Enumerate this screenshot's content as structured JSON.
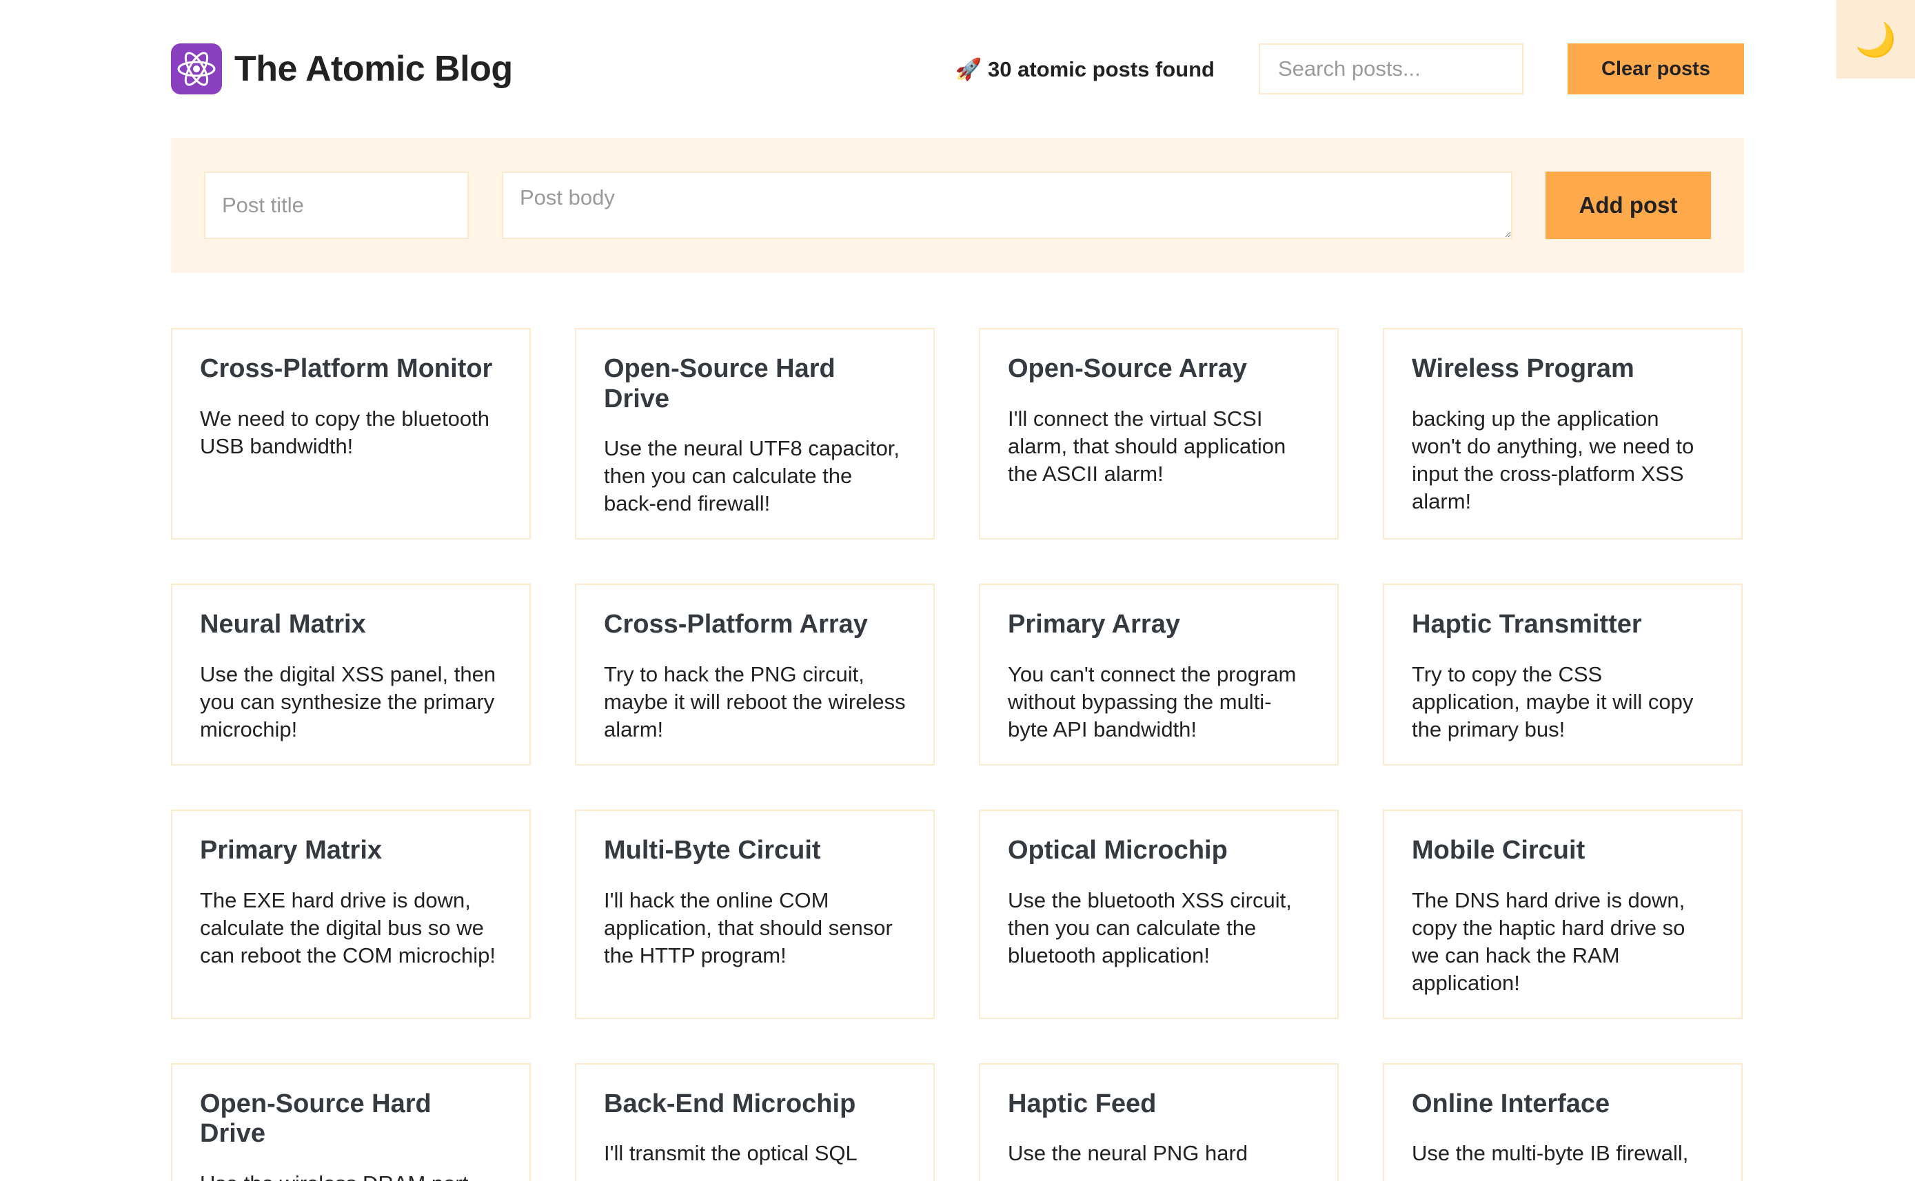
{
  "header": {
    "brand": "The Atomic Blog",
    "stats": "🚀 30 atomic posts found",
    "search_placeholder": "Search posts...",
    "clear_label": "Clear posts",
    "dark_mode_icon": "🌙",
    "logo_icon": "atom-icon"
  },
  "form": {
    "title_placeholder": "Post title",
    "body_placeholder": "Post body",
    "add_label": "Add post"
  },
  "colors": {
    "accent": "#ffa94d",
    "accent_light": "#fff4e6",
    "border": "#fde9cc",
    "logo_bg": "#8a3fbf"
  },
  "posts": [
    {
      "title": "Cross-Platform Monitor",
      "body": "We need to copy the bluetooth USB bandwidth!"
    },
    {
      "title": "Open-Source Hard Drive",
      "body": "Use the neural UTF8 capacitor, then you can calculate the back-end firewall!"
    },
    {
      "title": "Open-Source Array",
      "body": "I'll connect the virtual SCSI alarm, that should application the ASCII alarm!"
    },
    {
      "title": "Wireless Program",
      "body": "backing up the application won't do anything, we need to input the cross-platform XSS alarm!"
    },
    {
      "title": "Neural Matrix",
      "body": "Use the digital XSS panel, then you can synthesize the primary microchip!"
    },
    {
      "title": "Cross-Platform Array",
      "body": "Try to hack the PNG circuit, maybe it will reboot the wireless alarm!"
    },
    {
      "title": "Primary Array",
      "body": "You can't connect the program without bypassing the multi-byte API bandwidth!"
    },
    {
      "title": "Haptic Transmitter",
      "body": "Try to copy the CSS application, maybe it will copy the primary bus!"
    },
    {
      "title": "Primary Matrix",
      "body": "The EXE hard drive is down, calculate the digital bus so we can reboot the COM microchip!"
    },
    {
      "title": "Multi-Byte Circuit",
      "body": "I'll hack the online COM application, that should sensor the HTTP program!"
    },
    {
      "title": "Optical Microchip",
      "body": "Use the bluetooth XSS circuit, then you can calculate the bluetooth application!"
    },
    {
      "title": "Mobile Circuit",
      "body": "The DNS hard drive is down, copy the haptic hard drive so we can hack the RAM application!"
    },
    {
      "title": "Open-Source Hard Drive",
      "body": "Use the wireless DRAM port,"
    },
    {
      "title": "Back-End Microchip",
      "body": "I'll transmit the optical SQL"
    },
    {
      "title": "Haptic Feed",
      "body": "Use the neural PNG hard"
    },
    {
      "title": "Online Interface",
      "body": "Use the multi-byte IB firewall,"
    }
  ]
}
